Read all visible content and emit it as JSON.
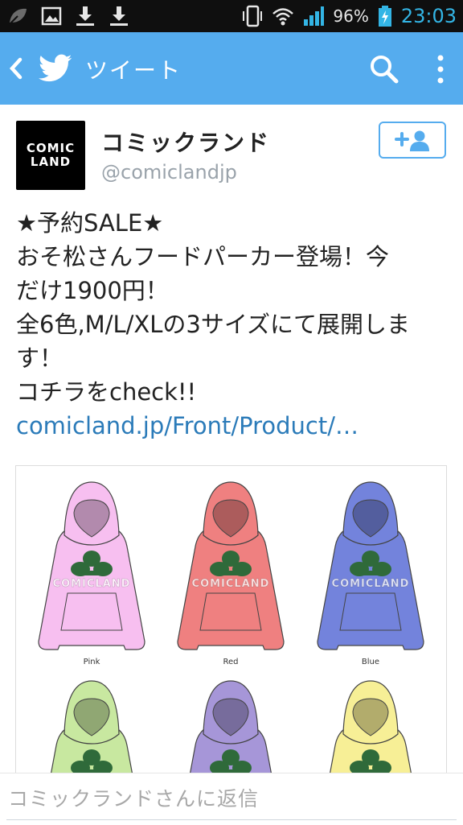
{
  "status_bar": {
    "battery_percent": "96%",
    "time": "23:03",
    "time_color": "#33b5e5"
  },
  "app_bar": {
    "title": "ツイート",
    "color": "#55acee"
  },
  "profile": {
    "avatar_line1": "COMIC",
    "avatar_line2": "LAND",
    "name": "コミックランド",
    "handle": "@comiclandjp"
  },
  "tweet": {
    "lines": [
      "★予約SALE★",
      "おそ松さんフードパーカー登場！今",
      "だけ1900円！",
      "全6色,M/L/XLの3サイズにて展開しま",
      "す！",
      "コチラをcheck!!"
    ],
    "link": "comicland.jp/Front/Product/…"
  },
  "media": {
    "watermark": "COMICLAND",
    "hoodies": [
      {
        "label": "Pink",
        "color": "#f7bff0"
      },
      {
        "label": "Red",
        "color": "#ef8080"
      },
      {
        "label": "Blue",
        "color": "#7383dc"
      },
      {
        "label": "",
        "color": "#c8e8a0"
      },
      {
        "label": "",
        "color": "#a696d8"
      },
      {
        "label": "",
        "color": "#f7ef96"
      }
    ]
  },
  "reply": {
    "placeholder": "コミックランドさんに返信"
  }
}
